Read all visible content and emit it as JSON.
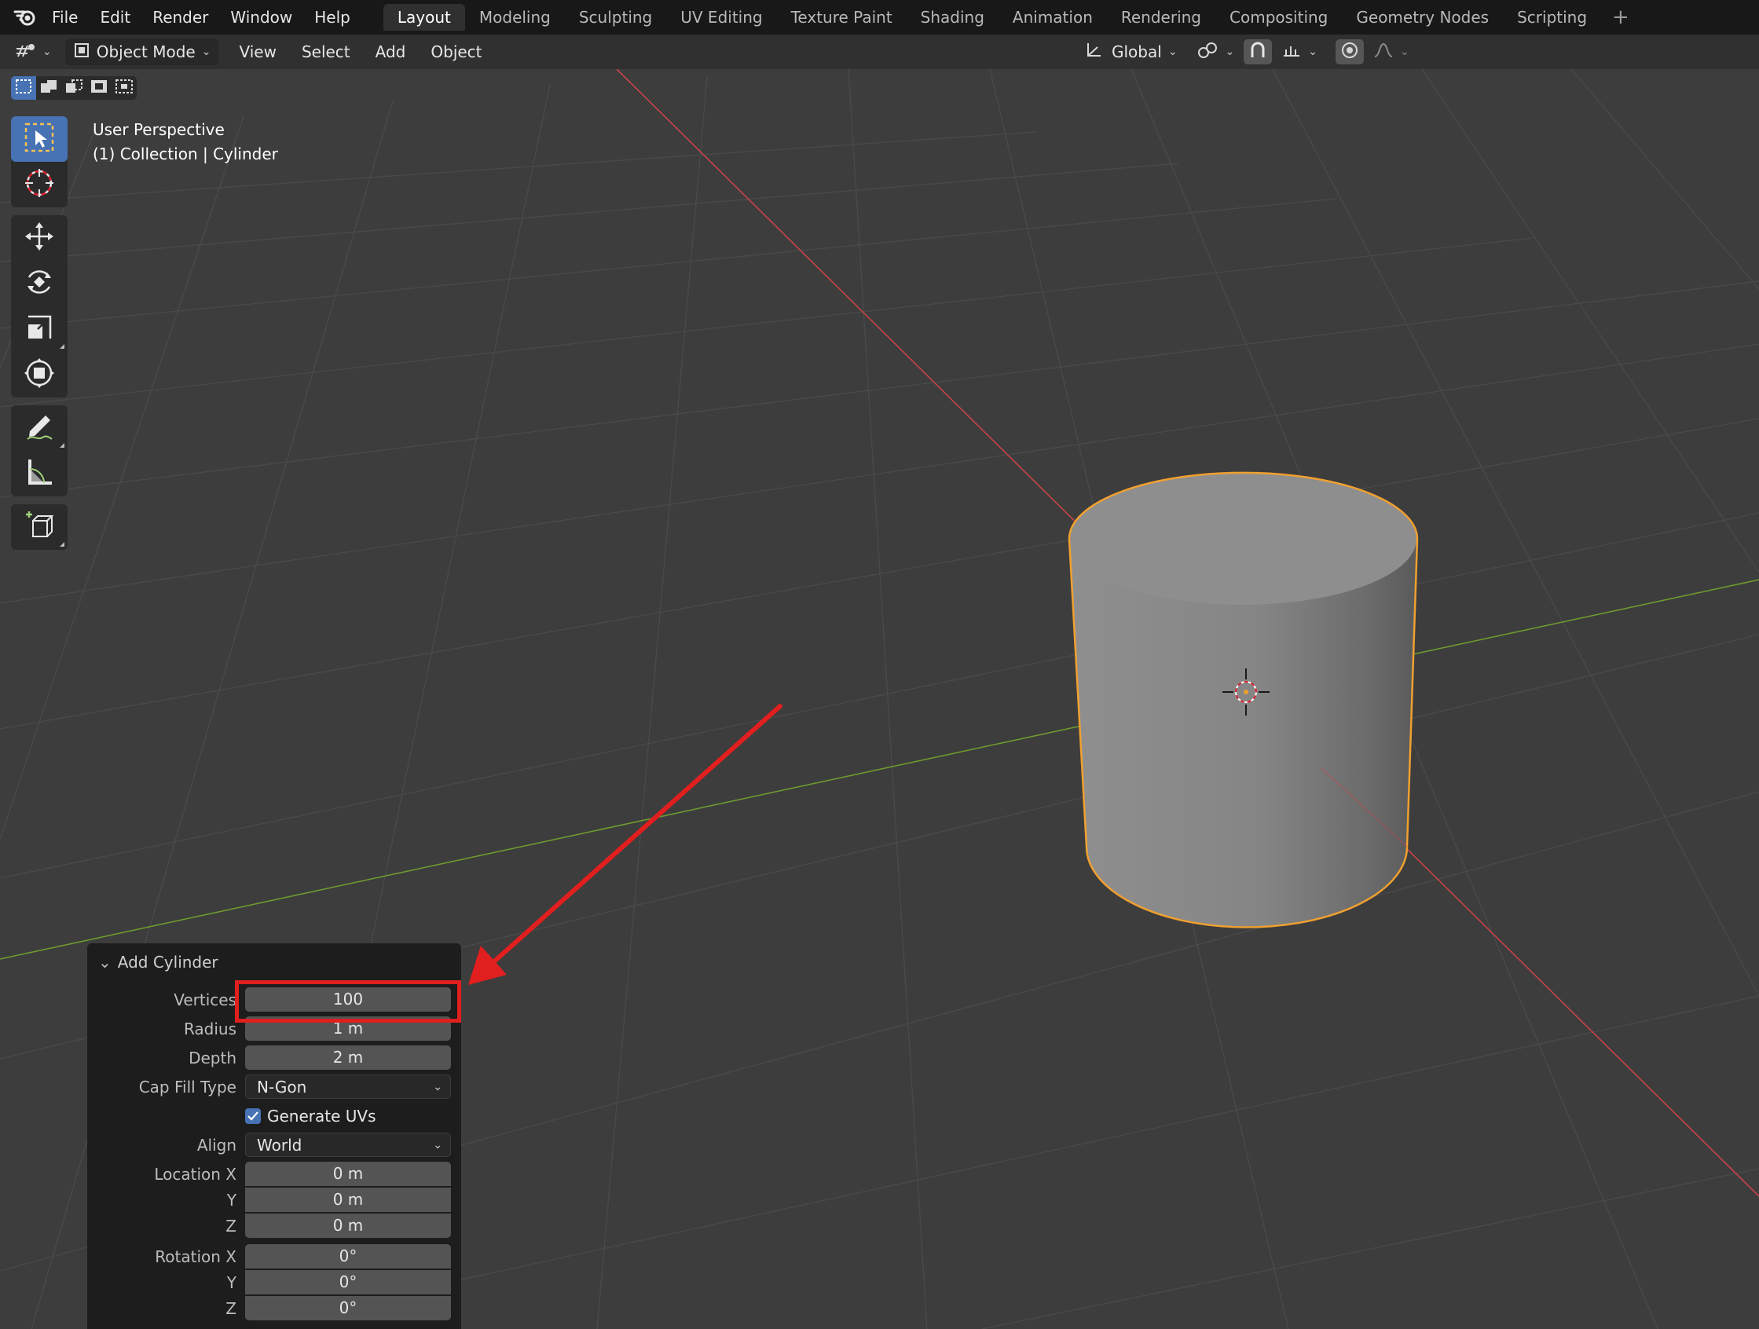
{
  "topbar": {
    "menus": [
      "File",
      "Edit",
      "Render",
      "Window",
      "Help"
    ],
    "workspaces": [
      "Layout",
      "Modeling",
      "Sculpting",
      "UV Editing",
      "Texture Paint",
      "Shading",
      "Animation",
      "Rendering",
      "Compositing",
      "Geometry Nodes",
      "Scripting"
    ],
    "active_workspace": "Layout",
    "add_workspace": "+"
  },
  "header": {
    "mode": "Object Mode",
    "menus": [
      "View",
      "Select",
      "Add",
      "Object"
    ],
    "transform_orientation": "Global"
  },
  "viewport": {
    "view_name": "User Perspective",
    "collection_info": "(1) Collection | Cylinder",
    "selected_outline_color": "#f0a030",
    "x_axis_color": "#c94348",
    "y_axis_color": "#6e9a2f",
    "annotation_color": "#e11f1f"
  },
  "toolbar": {
    "tools": [
      "select-box",
      "cursor",
      "move",
      "rotate",
      "scale",
      "transform",
      "annotate",
      "measure",
      "add-cube"
    ],
    "active_tool": "select-box",
    "accent": "#4772b3"
  },
  "operator_panel": {
    "title": "Add Cylinder",
    "vertices_label": "Vertices",
    "vertices": "100",
    "radius_label": "Radius",
    "radius": "1 m",
    "depth_label": "Depth",
    "depth": "2 m",
    "cap_fill_label": "Cap Fill Type",
    "cap_fill": "N-Gon",
    "generate_uvs_label": "Generate UVs",
    "generate_uvs": true,
    "align_label": "Align",
    "align": "World",
    "location_label": "Location X",
    "location_x": "0 m",
    "y_label": "Y",
    "location_y": "0 m",
    "z_label": "Z",
    "location_z": "0 m",
    "rotation_label": "Rotation X",
    "rotation_x": "0°",
    "rotation_y": "0°",
    "rotation_z": "0°"
  }
}
